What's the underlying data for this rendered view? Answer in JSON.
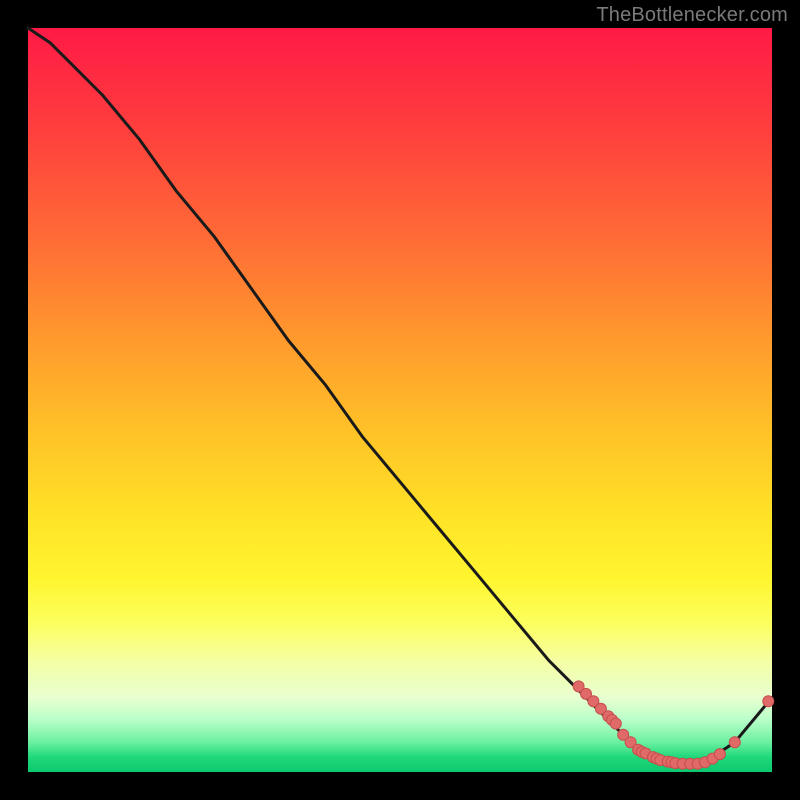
{
  "attribution": "TheBottlenecker.com",
  "colors": {
    "frame": "#000000",
    "curve_stroke": "#1a1a1a",
    "point_fill": "#e06a68",
    "point_stroke": "#c64f4e"
  },
  "chart_data": {
    "type": "line",
    "title": "",
    "xlabel": "",
    "ylabel": "",
    "xlim": [
      0,
      100
    ],
    "ylim": [
      0,
      100
    ],
    "grid": false,
    "legend": false,
    "series": [
      {
        "name": "bottleneck-curve",
        "x": [
          0,
          3,
          6,
          10,
          15,
          20,
          25,
          30,
          35,
          40,
          45,
          50,
          55,
          60,
          65,
          70,
          75,
          78,
          80,
          82,
          84,
          86,
          88,
          90,
          92,
          95,
          100
        ],
        "y": [
          100,
          98,
          95,
          91,
          85,
          78,
          72,
          65,
          58,
          52,
          45,
          39,
          33,
          27,
          21,
          15,
          10,
          7,
          5,
          3,
          2,
          1,
          1,
          1,
          2,
          4,
          10
        ]
      }
    ],
    "highlight_points": {
      "name": "marked-points",
      "x": [
        74,
        75,
        76,
        77,
        78,
        78.5,
        79,
        80,
        81,
        82,
        82.5,
        83,
        84,
        84.5,
        85,
        86,
        86.5,
        87,
        88,
        89,
        90,
        91,
        92,
        93,
        95,
        99.5
      ],
      "y": [
        11.5,
        10.5,
        9.5,
        8.5,
        7.5,
        7,
        6.5,
        5,
        4,
        3,
        2.7,
        2.5,
        2,
        1.8,
        1.6,
        1.4,
        1.3,
        1.2,
        1.1,
        1.1,
        1.1,
        1.3,
        1.8,
        2.4,
        4,
        9.5
      ]
    }
  }
}
